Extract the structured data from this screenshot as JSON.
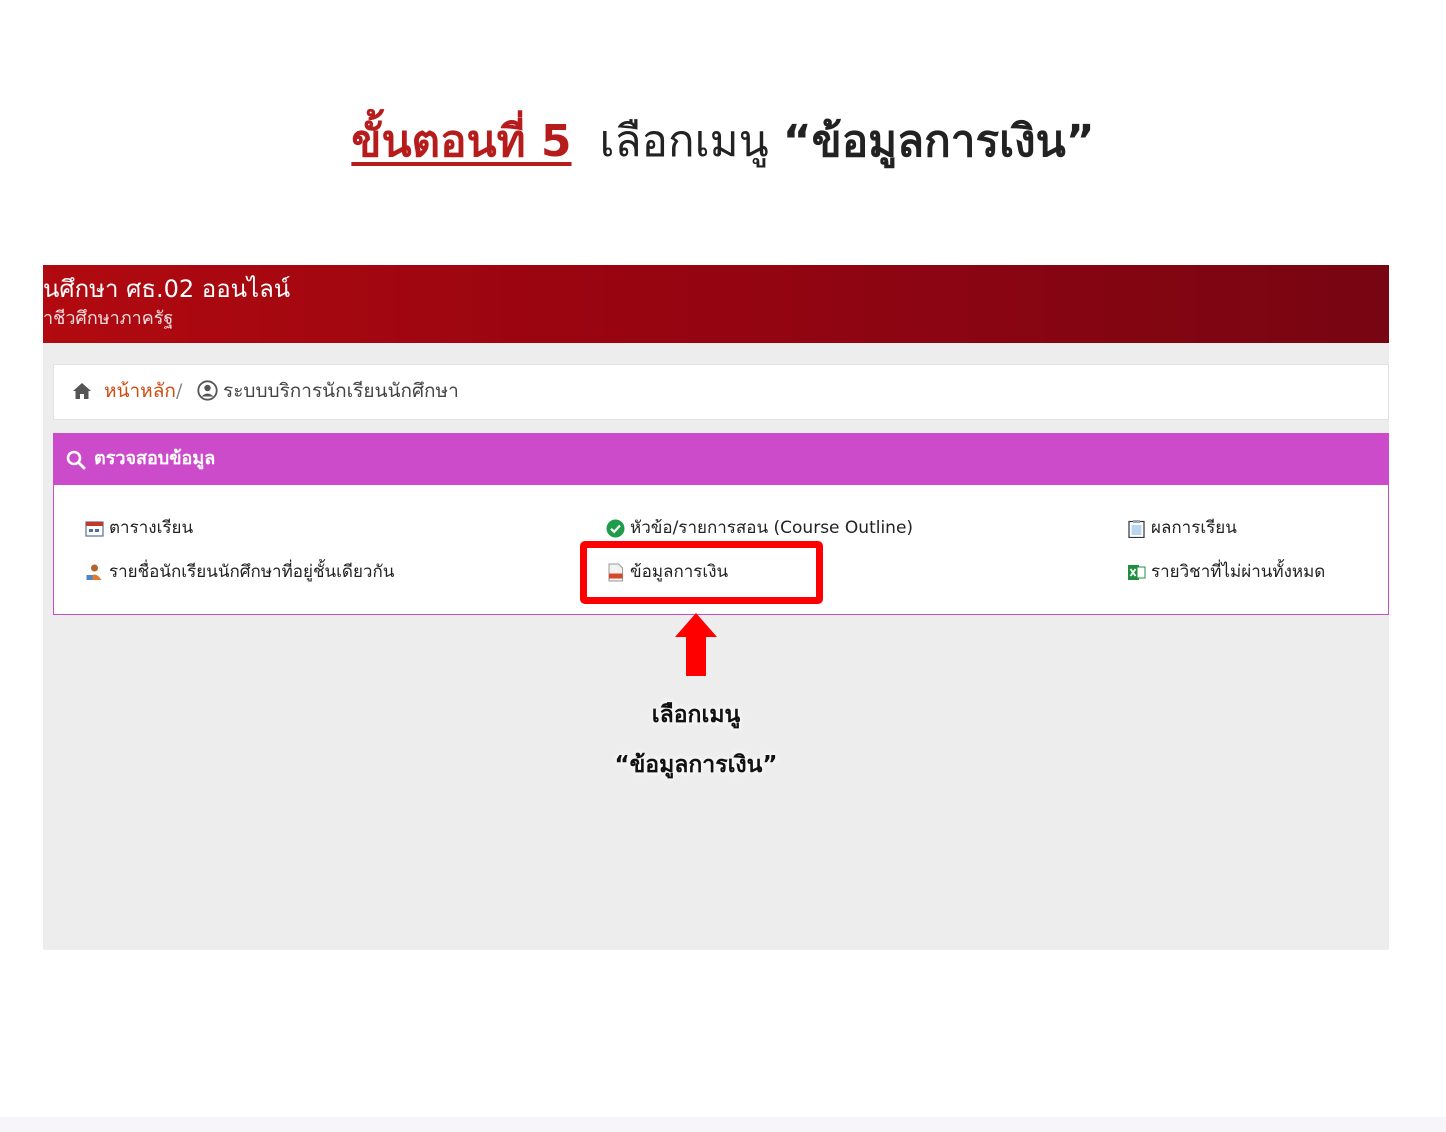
{
  "instruction": {
    "step_label": "ขั้นตอนที่ 5",
    "text": "เลือกเมนู",
    "menu_name": "“ข้อมูลการเงิน”"
  },
  "screenshot": {
    "banner": {
      "title": "นศึกษา ศธ.02 ออนไลน์",
      "subtitle": "าชีวศึกษาภาครัฐ"
    },
    "breadcrumb": {
      "home": "หน้าหลัก",
      "separator": "/",
      "current": "ระบบบริการนักเรียนนักศึกษา"
    },
    "panel": {
      "title": "ตรวจสอบข้อมูล",
      "items": [
        {
          "label": "ตารางเรียน",
          "icon": "calendar-icon"
        },
        {
          "label": "หัวข้อ/รายการสอน (Course Outline)",
          "icon": "check-circle-icon"
        },
        {
          "label": "ผลการเรียน",
          "icon": "clipboard-icon"
        },
        {
          "label": "รายชื่อนักเรียนนักศึกษาที่อยู่ชั้นเดียวกัน",
          "icon": "students-icon"
        },
        {
          "label": "ข้อมูลการเงิน",
          "icon": "pdf-file-icon"
        },
        {
          "label": "รายวิชาที่ไม่ผ่านทั้งหมด",
          "icon": "excel-icon"
        }
      ]
    }
  },
  "annotation": {
    "line1": "เลือกเมนู",
    "line2": "“ข้อมูลการเงิน”",
    "highlight_color": "#ff0000"
  },
  "colors": {
    "banner": "#9c0510",
    "panel_header": "#cc4bca",
    "step_label": "#b71c1c",
    "breadcrumb_link": "#cf4b10"
  }
}
